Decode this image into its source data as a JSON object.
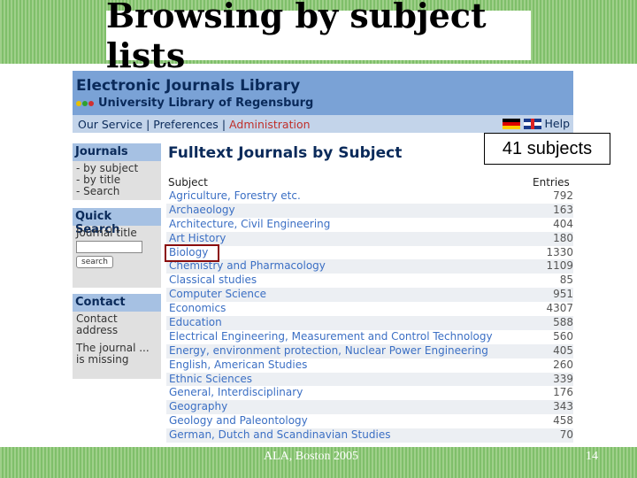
{
  "slide": {
    "title": "Browsing by subject lists",
    "footer_left": "ALA, Boston 2005",
    "page_number": "14",
    "callout": "41 subjects"
  },
  "site": {
    "name": "Electronic Journals Library",
    "university": "University Library of Regensburg",
    "nav": {
      "our_service": "Our Service",
      "sep1": "|",
      "preferences": "Preferences",
      "sep2": "|",
      "administration": "Administration",
      "help": "Help"
    }
  },
  "sidebar": {
    "journals": {
      "heading": "Journals",
      "items": [
        "- by subject",
        "- by title",
        "- Search"
      ]
    },
    "quick_search": {
      "heading": "Quick Search",
      "label": "Journal title",
      "input_value": "",
      "button": "search"
    },
    "contact": {
      "heading": "Contact",
      "line1": "Contact",
      "line2": "address",
      "line3": "The journal ...",
      "line4": "is missing"
    }
  },
  "main": {
    "title": "Fulltext Journals by Subject",
    "col_subject": "Subject",
    "col_entries": "Entries",
    "rows": [
      {
        "subject": "Agriculture, Forestry etc.",
        "entries": "792"
      },
      {
        "subject": "Archaeology",
        "entries": "163"
      },
      {
        "subject": "Architecture, Civil Engineering",
        "entries": "404"
      },
      {
        "subject": "Art History",
        "entries": "180"
      },
      {
        "subject": "Biology",
        "entries": "1330"
      },
      {
        "subject": "Chemistry and Pharmacology",
        "entries": "1109"
      },
      {
        "subject": "Classical studies",
        "entries": "85"
      },
      {
        "subject": "Computer Science",
        "entries": "951"
      },
      {
        "subject": "Economics",
        "entries": "4307"
      },
      {
        "subject": "Education",
        "entries": "588"
      },
      {
        "subject": "Electrical Engineering, Measurement and Control Technology",
        "entries": "560"
      },
      {
        "subject": "Energy, environment protection, Nuclear Power Engineering",
        "entries": "405"
      },
      {
        "subject": "English, American Studies",
        "entries": "260"
      },
      {
        "subject": "Ethnic Sciences",
        "entries": "339"
      },
      {
        "subject": "General, Interdisciplinary",
        "entries": "176"
      },
      {
        "subject": "Geography",
        "entries": "343"
      },
      {
        "subject": "Geology and Paleontology",
        "entries": "458"
      },
      {
        "subject": "German, Dutch and Scandinavian Studies",
        "entries": "70"
      }
    ]
  },
  "colors": {
    "header_blue": "#7aa2d6",
    "link_blue": "#3b6fc4",
    "admin_red": "#c0302a",
    "highlight": "#8b0d0d",
    "band_green": "#8cc77a"
  },
  "icons": [
    "german-flag-icon",
    "uk-flag-icon",
    "traffic-light-icon"
  ]
}
